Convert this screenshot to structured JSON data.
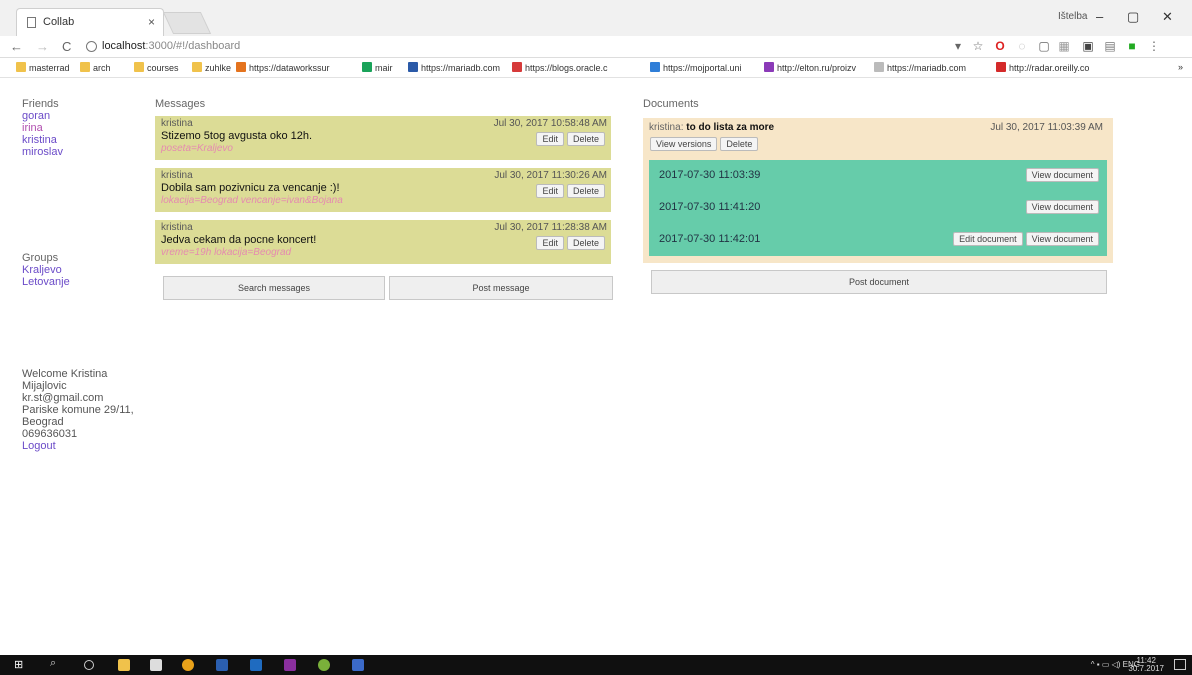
{
  "browser": {
    "tab_title": "Collab",
    "tab_close": "×",
    "user_name": "Ištelba",
    "win_min": "–",
    "win_max": "▢",
    "win_close": "✕",
    "back": "←",
    "forward": "→",
    "reload": "C",
    "url_host": "localhost",
    "url_path": ":3000/#!/dashboard",
    "bookmarks": [
      {
        "label": "masterrad",
        "color": "#f0c24b"
      },
      {
        "label": "arch",
        "color": "#f0c24b"
      },
      {
        "label": "courses",
        "color": "#f0c24b"
      },
      {
        "label": "zuhlke",
        "color": "#f0c24b"
      },
      {
        "label": "https://dataworkssur",
        "color": "#e4731e"
      },
      {
        "label": "mair",
        "color": "#1aa35a"
      },
      {
        "label": "https://mariadb.com",
        "color": "#2b5aa8"
      },
      {
        "label": "https://blogs.oracle.c",
        "color": "#d63a3a"
      },
      {
        "label": "https://mojportal.uni",
        "color": "#2f7ed8"
      },
      {
        "label": "http://elton.ru/proizv",
        "color": "#8b3ab8"
      },
      {
        "label": "https://mariadb.com",
        "color": "#bbbbbb"
      },
      {
        "label": "http://radar.oreilly.co",
        "color": "#d42a2a"
      }
    ],
    "bookmark_more": "»"
  },
  "sidebar": {
    "friends_heading": "Friends",
    "friends": [
      "goran",
      "irina",
      "kristina",
      "miroslav"
    ],
    "groups_heading": "Groups",
    "groups": [
      "Kraljevo",
      "Letovanje"
    ],
    "welcome": "Welcome Kristina",
    "surname": "Mijajlovic",
    "email": "kr.st@gmail.com",
    "address": "Pariske komune 29/11,",
    "city": "Beograd",
    "phone": "069636031",
    "logout": "Logout"
  },
  "messages": {
    "heading": "Messages",
    "edit_label": "Edit",
    "delete_label": "Delete",
    "items": [
      {
        "author": "kristina",
        "date": "Jul 30, 2017 10:58:48 AM",
        "text": "Stizemo 5tog avgusta oko 12h.",
        "tags": "poseta=Kraljevo"
      },
      {
        "author": "kristina",
        "date": "Jul 30, 2017 11:30:26 AM",
        "text": "Dobila sam pozivnicu za vencanje :)!",
        "tags": "lokacija=Beograd vencanje=ivan&Bojana"
      },
      {
        "author": "kristina",
        "date": "Jul 30, 2017 11:28:38 AM",
        "text": "Jedva cekam da pocne koncert!",
        "tags": "vreme=19h lokacija=Beograd"
      }
    ],
    "search_button": "Search messages",
    "post_button": "Post message"
  },
  "documents": {
    "heading": "Documents",
    "owner": "kristina",
    "title": "to do lista za more",
    "date": "Jul 30, 2017 11:03:39 AM",
    "view_versions": "View versions",
    "delete": "Delete",
    "versions": [
      {
        "date": "2017-07-30 11:03:39"
      },
      {
        "date": "2017-07-30 11:41:20"
      },
      {
        "date": "2017-07-30 11:42:01"
      }
    ],
    "edit_document": "Edit document",
    "view_document": "View document",
    "post_document": "Post document"
  },
  "taskbar": {
    "lang": "ENG",
    "time": "11:42",
    "date": "30.7.2017"
  }
}
